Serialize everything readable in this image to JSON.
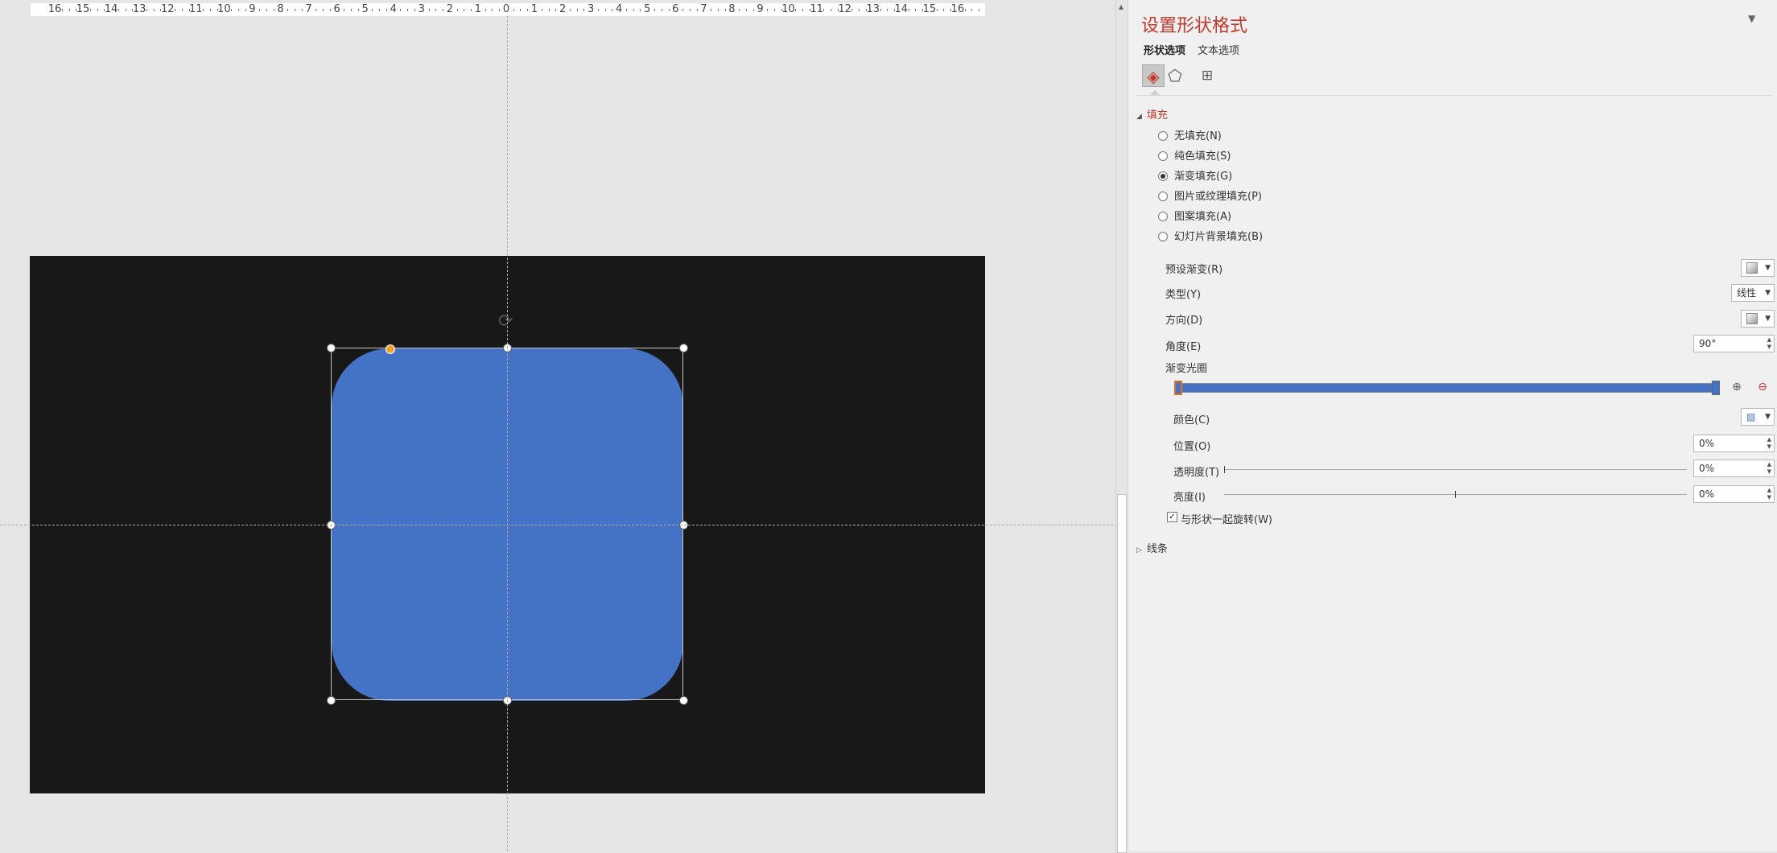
{
  "ruler": {
    "labels": [
      "16",
      "15",
      "14",
      "13",
      "12",
      "11",
      "10",
      "9",
      "8",
      "7",
      "6",
      "5",
      "4",
      "3",
      "2",
      "1",
      "0",
      "1",
      "2",
      "3",
      "4",
      "5",
      "6",
      "7",
      "8",
      "9",
      "10",
      "11",
      "12",
      "13",
      "14",
      "15",
      "16"
    ]
  },
  "pane": {
    "title": "设置形状格式",
    "tabs": [
      "形状选项",
      "文本选项"
    ],
    "fill_section": "填充",
    "line_section": "线条",
    "fill_options": [
      {
        "label": "无填充(N)",
        "selected": false
      },
      {
        "label": "纯色填充(S)",
        "selected": false
      },
      {
        "label": "渐变填充(G)",
        "selected": true
      },
      {
        "label": "图片或纹理填充(P)",
        "selected": false
      },
      {
        "label": "图案填充(A)",
        "selected": false
      },
      {
        "label": "幻灯片背景填充(B)",
        "selected": false
      }
    ],
    "preset_label": "预设渐变(R)",
    "type_label": "类型(Y)",
    "type_value": "线性",
    "direction_label": "方向(D)",
    "angle_label": "角度(E)",
    "angle_value": "90°",
    "stops_label": "渐变光圈",
    "color_label": "颜色(C)",
    "position_label": "位置(O)",
    "position_value": "0%",
    "transparency_label": "透明度(T)",
    "transparency_value": "0%",
    "brightness_label": "亮度(I)",
    "brightness_value": "0%",
    "rotate_label": "与形状一起旋转(W)",
    "rotate_checked": true
  },
  "colors": {
    "shape_fill": "#4472c4",
    "slide_bg": "#181818",
    "accent": "#c0392b",
    "stop_selected": "#e07020"
  },
  "gradient": {
    "stops_percent": [
      0,
      100
    ],
    "transparency": 0,
    "brightness": 0
  }
}
